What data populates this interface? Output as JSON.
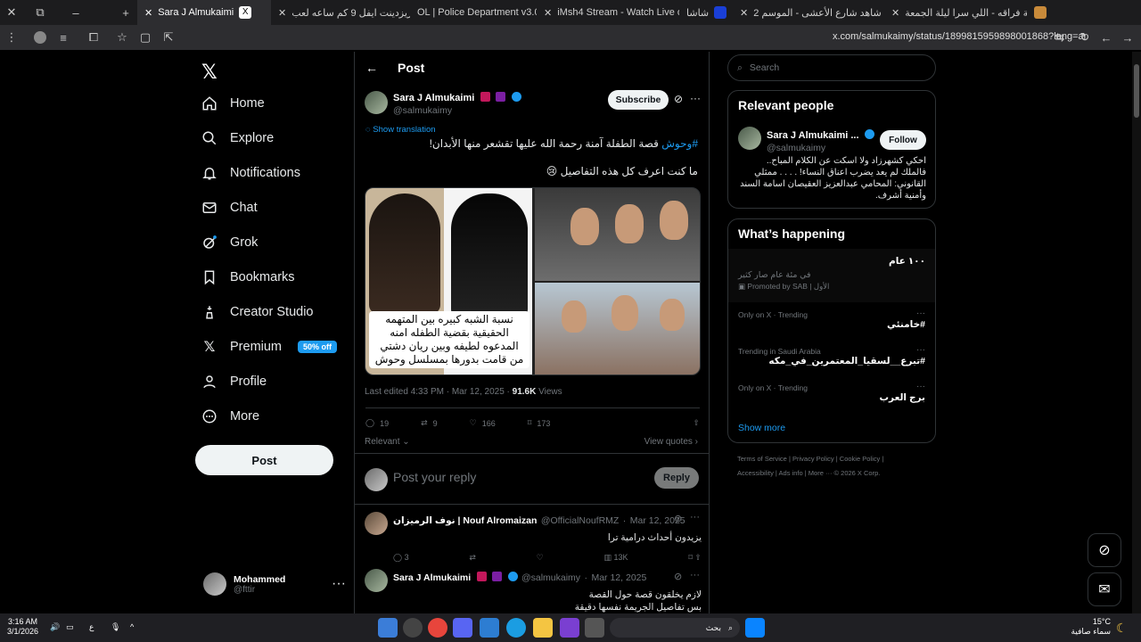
{
  "browser": {
    "tabs": [
      {
        "label": "Sara J Almukaimi",
        "color": "#ffffff",
        "active": true
      },
      {
        "label": "ريزدينت ايفل 9 كم ساعه لعب -",
        "color": "#ffffff"
      },
      {
        "label": "OL | Police Department v3.0 -",
        "color": "#2ea043"
      },
      {
        "label": "iMsh4 Stream - Watch Live on",
        "color": "#53fc18"
      },
      {
        "label": "شاشا",
        "color": "#1a3fd6"
      },
      {
        "label": "شاهد شارع الأعشى - الموسم 2",
        "color": "#21b46d"
      },
      {
        "label": "ليلة فراقه - اللي سرا ليلة الجمعة",
        "color": "#ff0000"
      }
    ],
    "url": "x.com/salmukaimy/status/1899815959898001868?lang=ar"
  },
  "nav": {
    "items": [
      {
        "label": "Home",
        "icon": "home-icon"
      },
      {
        "label": "Explore",
        "icon": "search-icon"
      },
      {
        "label": "Notifications",
        "icon": "bell-icon"
      },
      {
        "label": "Chat",
        "icon": "mail-icon"
      },
      {
        "label": "Grok",
        "icon": "grok-icon"
      },
      {
        "label": "Bookmarks",
        "icon": "bookmark-icon"
      },
      {
        "label": "Creator Studio",
        "icon": "creator-icon"
      },
      {
        "label": "Premium",
        "icon": "x-logo-icon"
      },
      {
        "label": "Profile",
        "icon": "person-icon"
      },
      {
        "label": "More",
        "icon": "more-circle-icon"
      }
    ],
    "premium_badge": "50% off",
    "post_button": "Post",
    "account": {
      "name": "Mohammed",
      "handle": "@fttir"
    }
  },
  "post": {
    "header": "Post",
    "author_name": "Sara J Almukaimi",
    "author_handle": "@salmukaimy",
    "subscribe": "Subscribe",
    "show_translation": "Show translation",
    "hashtag": "#وحوش",
    "text1": "قصة الطفلة آمنة رحمة الله عليها تقشعر منها الأبدان!",
    "text2": "ما كنت اعرف كل هذه التفاصيل 😢",
    "image_caption": "نسبة الشبه كبيره بين المتهمه الحقيقية بقضية الطفله امنه المدعوه لطيفه وبين ريان دشتي من قامت بدورها بمسلسل وحوش",
    "meta": "Last edited 4:33 PM · Mar 12, 2025 · ",
    "views_count": "91.6K",
    "views_label": " Views",
    "stats": {
      "replies": "19",
      "reposts": "9",
      "likes": "166",
      "bookmarks": "173"
    },
    "relevant": "Relevant",
    "view_quotes": "View quotes",
    "reply_placeholder": "Post your reply",
    "reply_button": "Reply"
  },
  "replies": [
    {
      "name": "نوف الرميزان | Nouf Alromaizan",
      "handle": "@OfficialNoufRMZ",
      "date": "Mar 12, 2025",
      "text": "يزيدون أحداث درامية ترا",
      "stats": {
        "replies": "3",
        "views": "13K"
      }
    },
    {
      "name": "Sara J Almukaimi",
      "handle": "@salmukaimy",
      "date": "Mar 12, 2025",
      "text": "لازم يخلقون قصة حول القصة\nبس تفاصيل الجريمة نفسها دقيقة"
    }
  ],
  "right": {
    "search_placeholder": "Search",
    "relevant_title": "Relevant people",
    "person": {
      "name": "Sara J Almukaimi ...",
      "handle": "@salmukaimy",
      "follow": "Follow",
      "bio": "احكي كشهرزاد ولا اسكت عن الكلام المباح.. فالملك لم يعد يضرب اعناق النساء! . . . . ممثلي القانوني: المحامي عبدالعزيز العقيصان اسامة السند وأمنية أشرف."
    },
    "happening_title": "What’s happening",
    "trends": [
      {
        "context": "",
        "name": "١٠٠ عام",
        "sub": "في مئة عام صار كثير",
        "promo": "Promoted by SAB | الأول"
      },
      {
        "context": "Only on X · Trending",
        "name": "#خامنئي"
      },
      {
        "context": "Trending in Saudi Arabia",
        "name": "#تبرع__لسقيا_المعتمرين_في_مكه"
      },
      {
        "context": "Only on X · Trending",
        "name": "برج العرب"
      }
    ],
    "show_more": "Show more",
    "footer": [
      "Terms of Service",
      "Privacy Policy",
      "Cookie Policy",
      "Accessibility",
      "Ads info",
      "More ···",
      "© 2026 X Corp."
    ]
  },
  "taskbar": {
    "time": "3:16 AM",
    "date": "3/1/2026",
    "lang": "ع",
    "search": "بحث",
    "weather_temp": "15°C",
    "weather_desc": "سماء صافية"
  }
}
